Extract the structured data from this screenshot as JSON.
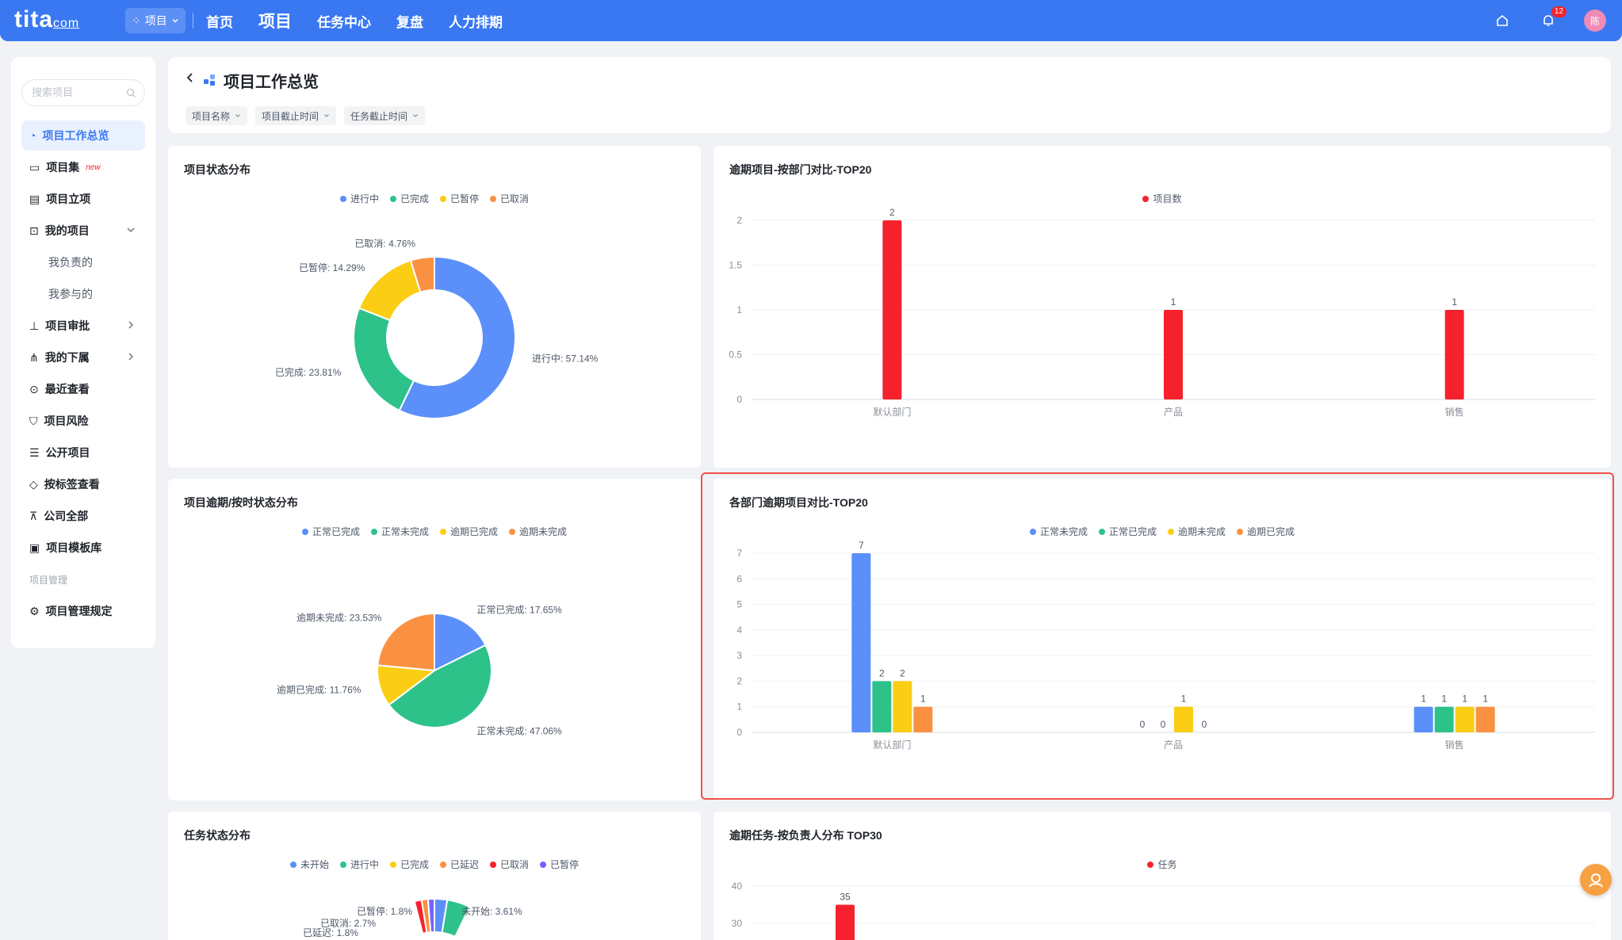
{
  "topbar": {
    "logo": "tita",
    "logo_suffix": "com",
    "project_switch": "项目",
    "nav": [
      "首页",
      "项目",
      "任务中心",
      "复盘",
      "人力排期"
    ],
    "active_nav": 1,
    "notification_count": "12",
    "avatar_text": "陈"
  },
  "sidebar": {
    "search_placeholder": "搜索项目",
    "items": [
      {
        "label": "项目工作总览",
        "icon": "dashboard-icon",
        "active": true
      },
      {
        "label": "项目集",
        "icon": "folder-icon",
        "tag": "new"
      },
      {
        "label": "项目立项",
        "icon": "form-icon"
      },
      {
        "label": "我的项目",
        "icon": "lock-icon",
        "arrow": "down"
      },
      {
        "label": "我负责的",
        "sub": true
      },
      {
        "label": "我参与的",
        "sub": true
      },
      {
        "label": "项目审批",
        "icon": "stamp-icon",
        "arrow": "right"
      },
      {
        "label": "我的下属",
        "icon": "org-icon",
        "arrow": "right"
      },
      {
        "label": "最近查看",
        "icon": "search-clock-icon"
      },
      {
        "label": "项目风险",
        "icon": "shield-icon"
      },
      {
        "label": "公开项目",
        "icon": "list-icon"
      },
      {
        "label": "按标签查看",
        "icon": "tag-icon"
      },
      {
        "label": "公司全部",
        "icon": "hierarchy-icon"
      },
      {
        "label": "项目模板库",
        "icon": "template-icon"
      },
      {
        "label": "项目管理",
        "group": true
      },
      {
        "label": "项目管理规定",
        "icon": "gear-icon"
      }
    ]
  },
  "header": {
    "title": "项目工作总览",
    "filters": [
      "项目名称",
      "项目截止时间",
      "任务截止时间"
    ]
  },
  "cards": {
    "status": {
      "title": "项目状态分布",
      "legend": [
        "进行中",
        "已完成",
        "已暂停",
        "已取消"
      ],
      "labels": [
        "进行中: 57.14%",
        "已完成: 23.81%",
        "已暂停: 14.29%",
        "已取消: 4.76%"
      ]
    },
    "overdue_dept": {
      "title": "逾期项目-按部门对比-TOP20",
      "legend": [
        "项目数"
      ]
    },
    "ontime": {
      "title": "项目逾期/按时状态分布",
      "legend": [
        "正常已完成",
        "正常未完成",
        "逾期已完成",
        "逾期未完成"
      ],
      "labels": [
        "正常已完成: 17.65%",
        "正常未完成: 47.06%",
        "逾期已完成: 11.76%",
        "逾期未完成: 23.53%"
      ]
    },
    "dept_compare": {
      "title": "各部门逾期项目对比-TOP20",
      "legend": [
        "正常未完成",
        "正常已完成",
        "逾期未完成",
        "逾期已完成"
      ]
    },
    "task_status": {
      "title": "任务状态分布",
      "legend": [
        "未开始",
        "进行中",
        "已完成",
        "已延迟",
        "已取消",
        "已暂停"
      ],
      "labels": [
        "已暂停: 1.8%",
        "未开始: 3.61%",
        "已取消: 2.7%",
        "已延迟: 1.8%"
      ]
    },
    "task_owner": {
      "title": "逾期任务-按负责人分布 TOP30",
      "legend": [
        "任务"
      ]
    }
  },
  "colors": {
    "blue": "#5b8ff9",
    "green": "#2ec28b",
    "yellow": "#fbcd14",
    "orange": "#fa9142",
    "red": "#f5222d",
    "purple": "#7262fd",
    "accent": "#3a78f2"
  },
  "chart_data": [
    {
      "type": "pie",
      "title": "项目状态分布",
      "categories": [
        "进行中",
        "已完成",
        "已暂停",
        "已取消"
      ],
      "values": [
        57.14,
        23.81,
        14.29,
        4.76
      ],
      "donut": true,
      "legend": "top"
    },
    {
      "type": "bar",
      "title": "逾期项目-按部门对比-TOP20",
      "categories": [
        "默认部门",
        "产品",
        "销售"
      ],
      "series": [
        {
          "name": "项目数",
          "values": [
            2,
            1,
            1
          ]
        }
      ],
      "ylim": [
        0,
        2
      ],
      "yticks": [
        "0",
        "0.5",
        "1",
        "1.5",
        "2"
      ],
      "grid": true,
      "legend": "top"
    },
    {
      "type": "pie",
      "title": "项目逾期/按时状态分布",
      "categories": [
        "正常已完成",
        "正常未完成",
        "逾期已完成",
        "逾期未完成"
      ],
      "values": [
        17.65,
        47.06,
        11.76,
        23.53
      ],
      "legend": "top"
    },
    {
      "type": "bar",
      "title": "各部门逾期项目对比-TOP20",
      "categories": [
        "默认部门",
        "产品",
        "销售"
      ],
      "series": [
        {
          "name": "正常未完成",
          "values": [
            7,
            0,
            1
          ]
        },
        {
          "name": "正常已完成",
          "values": [
            2,
            0,
            1
          ]
        },
        {
          "name": "逾期未完成",
          "values": [
            2,
            1,
            1
          ]
        },
        {
          "name": "逾期已完成",
          "values": [
            1,
            0,
            1
          ]
        }
      ],
      "ylim": [
        0,
        7
      ],
      "yticks": [
        "0",
        "1",
        "2",
        "3",
        "4",
        "5",
        "6",
        "7"
      ],
      "grid": true,
      "legend": "top"
    },
    {
      "type": "pie",
      "title": "任务状态分布",
      "categories": [
        "未开始",
        "进行中",
        "已完成",
        "已延迟",
        "已取消",
        "已暂停"
      ],
      "legend": "top"
    },
    {
      "type": "bar",
      "title": "逾期任务-按负责人分布 TOP30",
      "series": [
        {
          "name": "任务",
          "values": [
            35
          ]
        }
      ],
      "yticks": [
        "30",
        "40"
      ],
      "grid": true,
      "legend": "top"
    }
  ]
}
